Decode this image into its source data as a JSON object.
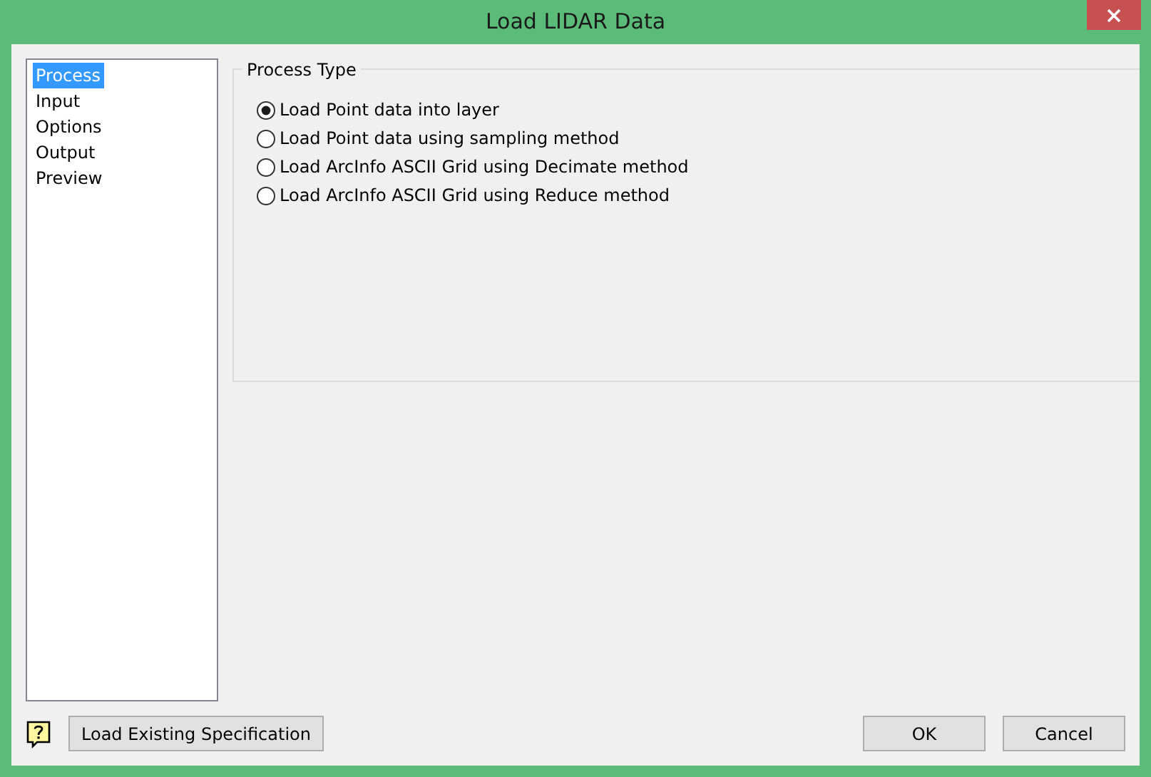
{
  "window": {
    "title": "Load LIDAR Data"
  },
  "sidebar": {
    "items": [
      {
        "label": "Process",
        "selected": true
      },
      {
        "label": "Input",
        "selected": false
      },
      {
        "label": "Options",
        "selected": false
      },
      {
        "label": "Output",
        "selected": false
      },
      {
        "label": "Preview",
        "selected": false
      }
    ]
  },
  "process_type": {
    "title": "Process Type",
    "options": [
      {
        "label": "Load Point data into layer",
        "selected": true
      },
      {
        "label": "Load Point data using sampling method",
        "selected": false
      },
      {
        "label": "Load ArcInfo ASCII Grid using Decimate method",
        "selected": false
      },
      {
        "label": "Load ArcInfo ASCII Grid using Reduce method",
        "selected": false
      }
    ]
  },
  "buttons": {
    "load_spec": "Load Existing Specification",
    "ok": "OK",
    "cancel": "Cancel"
  }
}
